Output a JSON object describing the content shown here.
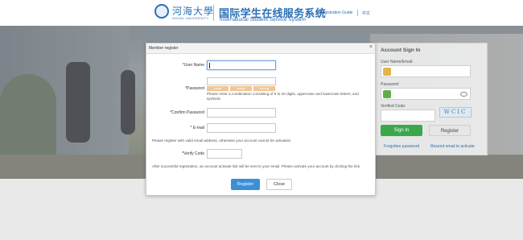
{
  "header": {
    "logo_cn": "河海大學",
    "logo_en": "HOHAI UNIVERSITY",
    "title_cn": "国际学生在线服务系统",
    "title_en": "International Student Service System",
    "links": [
      "Registration Guide",
      "中文"
    ]
  },
  "signin": {
    "title": "Account Sign In",
    "username_label": "User Name/Email:",
    "password_label": "Password:",
    "code_label": "Verified Code:",
    "captcha_text": "WCIC",
    "signin_button": "Sign In",
    "register_button": "Register",
    "forgot_link": "Forgotten password",
    "resend_link": "Resend email to activate"
  },
  "modal": {
    "title": "Member register",
    "close_glyph": "×",
    "username_label": "*User Name",
    "password_label": "*Password",
    "strength_levels": [
      "weak",
      "middle",
      "strong"
    ],
    "password_hint": "Please enter a combination consisting of 6 to 20 digits, uppercase and lowercase letters, and symbols",
    "confirm_label": "*Confirm Password",
    "email_label": "* E-mail",
    "email_note": "Please register with valid email address, otherwise your account cannot be activated.",
    "code_label": "*Verify Code",
    "activation_note": "After successful registration, an account activate link will be sent to your email. Please activate your account by clicking the link.",
    "register_button": "Register",
    "close_button": "Close"
  },
  "colors": {
    "brand": "#2c6fb5",
    "primary_button": "#3a8fd6",
    "signin_button": "#3aa84a",
    "strength_bar": "#f2c593"
  }
}
